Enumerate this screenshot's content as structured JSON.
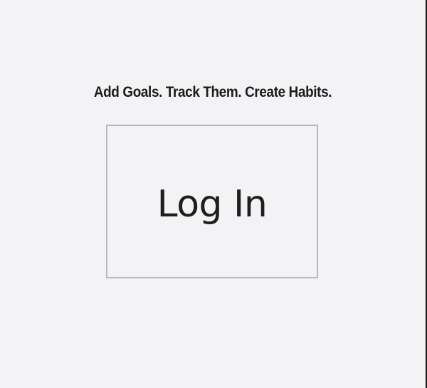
{
  "header": {
    "tagline": "Add Goals. Track Them. Create Habits."
  },
  "main": {
    "login_label": "Log In"
  }
}
